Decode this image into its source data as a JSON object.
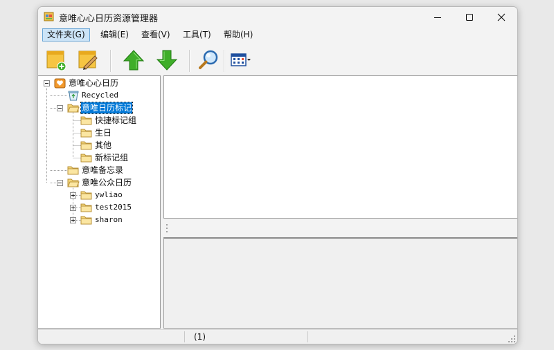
{
  "window": {
    "title": "意唯心心日历资源管理器"
  },
  "menu": {
    "items": [
      {
        "label": "文件夹(G)"
      },
      {
        "label": "编辑(E)"
      },
      {
        "label": "查看(V)"
      },
      {
        "label": "工具(T)"
      },
      {
        "label": "帮助(H)"
      }
    ]
  },
  "toolbar": {
    "buttons": [
      {
        "icon": "new-note-icon"
      },
      {
        "icon": "edit-note-icon"
      },
      {
        "icon": "arrow-up-icon"
      },
      {
        "icon": "arrow-down-icon"
      },
      {
        "icon": "search-icon"
      },
      {
        "icon": "view-grid-icon"
      }
    ]
  },
  "tree": {
    "root": {
      "label": "意唯心心日历"
    },
    "recycled": {
      "label": "Recycled"
    },
    "marks": {
      "label": "意唯日历标记",
      "selected": true
    },
    "quick": {
      "label": "快捷标记组"
    },
    "birthday": {
      "label": "生日"
    },
    "other": {
      "label": "其他"
    },
    "newgroup": {
      "label": "新标记组"
    },
    "memo": {
      "label": "意唯备忘录"
    },
    "public": {
      "label": "意唯公众日历"
    },
    "ywliao": {
      "label": "ywliao"
    },
    "test2015": {
      "label": "test2015"
    },
    "sharon": {
      "label": "sharon"
    }
  },
  "status": {
    "text": "(1)"
  },
  "colors": {
    "selection": "#0078d7",
    "folder": "#f5d77a",
    "arrow_green": "#3fae29"
  }
}
